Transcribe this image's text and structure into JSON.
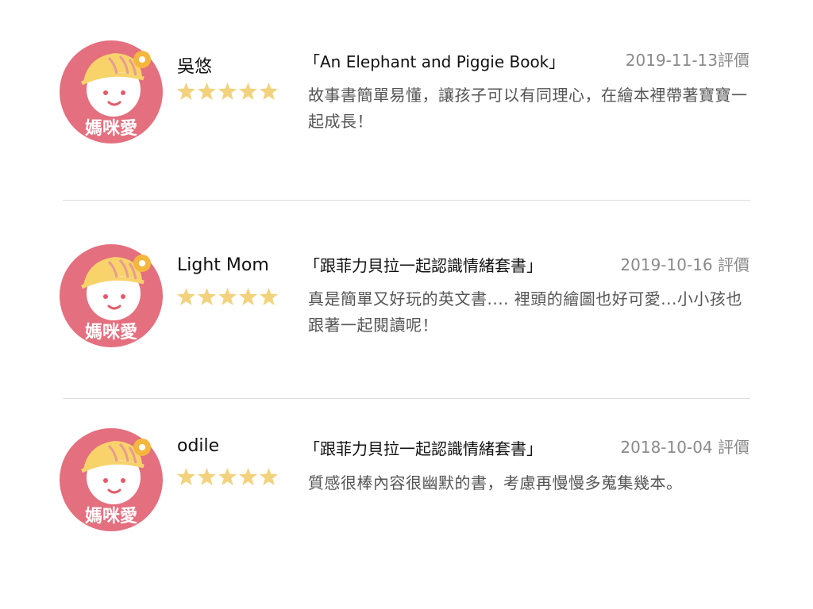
{
  "avatar": {
    "brand_text": "媽咪愛",
    "colors": {
      "circle": "#e46f7e",
      "hat": "#f7d36a",
      "hat_stripe": "#e89b93",
      "face": "#ffffff",
      "cheek": "#f3a6ac",
      "badge": "#f4b63f"
    }
  },
  "star_color": "#f2d27c",
  "reviews": [
    {
      "username": "吳悠",
      "rating": 5,
      "book_title": "「An Elephant and Piggie Book」",
      "date": "2019-11-13評價",
      "text": "故事書簡單易懂，讓孩子可以有同理心，在繪本裡帶著寶寶一起成長！"
    },
    {
      "username": "Light Mom",
      "rating": 5,
      "book_title": "「跟菲力貝拉一起認識情緒套書」",
      "date": "2019-10-16 評價",
      "text": "真是簡單又好玩的英文書....   裡頭的繪圖也好可愛...小小孩也跟著一起閱讀呢！"
    },
    {
      "username": "odile",
      "rating": 5,
      "book_title": "「跟菲力貝拉一起認識情緒套書」",
      "date": "2018-10-04 評價",
      "text": "質感很棒內容很幽默的書，考慮再慢慢多蒐集幾本。"
    }
  ]
}
